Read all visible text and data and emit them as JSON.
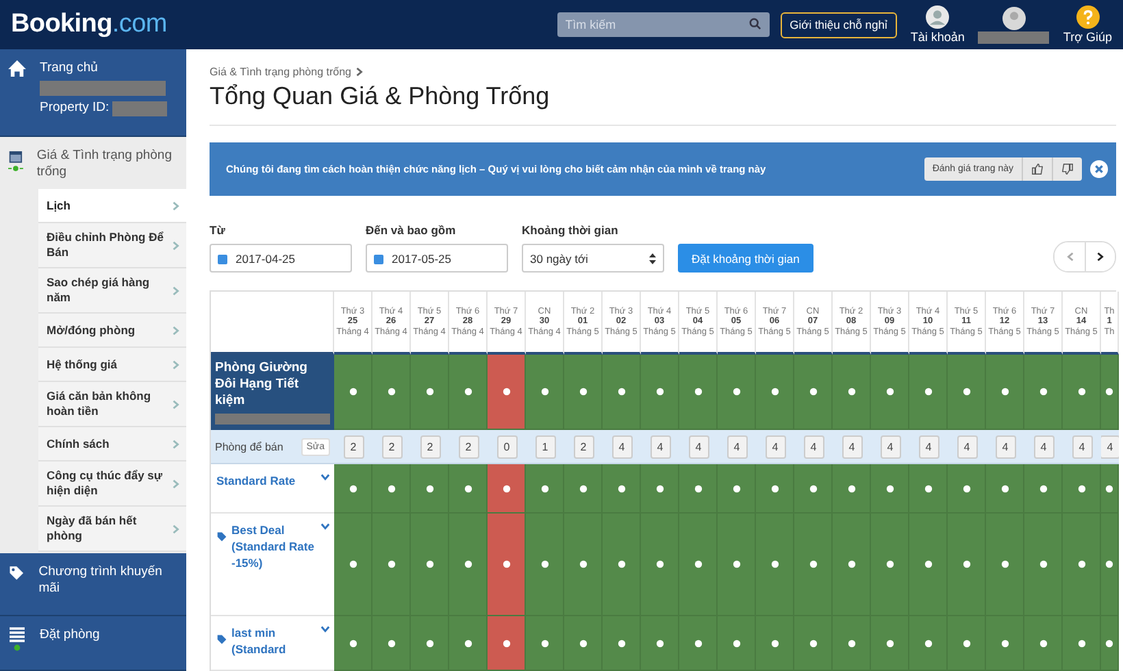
{
  "header": {
    "logo": {
      "main": "Booking",
      "suffix": ".com"
    },
    "search": {
      "placeholder": "Tìm kiếm"
    },
    "list_property": "Giới thiệu chỗ nghỉ",
    "account": "Tài khoản",
    "help": "Trợ Giúp"
  },
  "sidebar": {
    "home": {
      "label": "Trang chủ",
      "property_id": "Property ID:"
    },
    "section": {
      "label": "Giá & Tình trạng phòng trống",
      "items": [
        {
          "label": "Lịch",
          "selected": true
        },
        {
          "label": "Điều chỉnh Phòng Để Bán",
          "selected": false
        },
        {
          "label": "Sao chép giá hàng năm",
          "selected": false
        },
        {
          "label": "Mở/đóng phòng",
          "selected": false
        },
        {
          "label": "Hệ thống giá",
          "selected": false
        },
        {
          "label": "Giá căn bản không hoàn tiền",
          "selected": false
        },
        {
          "label": "Chính sách",
          "selected": false
        },
        {
          "label": "Công cụ thúc đẩy sự hiện diện",
          "selected": false
        },
        {
          "label": "Ngày đã bán hết phòng",
          "selected": false
        }
      ]
    },
    "bottom": [
      {
        "label": "Chương trình khuyến mãi",
        "kind": "tag"
      },
      {
        "label": "Đặt phòng",
        "kind": "list"
      }
    ]
  },
  "breadcrumb": "Giá & Tình trạng phòng trống",
  "title": "Tổng Quan Giá & Phòng Trống",
  "banner": {
    "text": "Chúng tôi đang tìm cách hoàn thiện chức năng lịch – Quý vị vui lòng cho biết cảm nhận của mình về trang này",
    "rate_label": "Đánh giá trang này"
  },
  "filters": {
    "from": {
      "label": "Từ",
      "value": "2017-04-25"
    },
    "to": {
      "label": "Đến và bao gồm",
      "value": "2017-05-25"
    },
    "range": {
      "label": "Khoảng thời gian",
      "value": "30 ngày tới"
    },
    "apply": "Đặt khoảng thời gian"
  },
  "calendar": {
    "room": "Phòng Giường Đôi Hạng Tiết kiệm",
    "rooms_label": "Phòng để bán",
    "edit": "Sửa",
    "rates": [
      {
        "label": "Standard Rate",
        "kind": "rate"
      },
      {
        "label": "Best Deal (Standard Rate -15%)",
        "kind": "deal"
      },
      {
        "label": "last min (Standard",
        "kind": "deal"
      }
    ],
    "days": [
      {
        "dow": "Thứ 3",
        "date": "25",
        "month": "Tháng 4",
        "rooms": "2",
        "closed": false
      },
      {
        "dow": "Thứ 4",
        "date": "26",
        "month": "Tháng 4",
        "rooms": "2",
        "closed": false
      },
      {
        "dow": "Thứ 5",
        "date": "27",
        "month": "Tháng 4",
        "rooms": "2",
        "closed": false
      },
      {
        "dow": "Thứ 6",
        "date": "28",
        "month": "Tháng 4",
        "rooms": "2",
        "closed": false
      },
      {
        "dow": "Thứ 7",
        "date": "29",
        "month": "Tháng 4",
        "rooms": "0",
        "closed": true
      },
      {
        "dow": "CN",
        "date": "30",
        "month": "Tháng 4",
        "rooms": "1",
        "closed": false
      },
      {
        "dow": "Thứ 2",
        "date": "01",
        "month": "Tháng 5",
        "rooms": "2",
        "closed": false
      },
      {
        "dow": "Thứ 3",
        "date": "02",
        "month": "Tháng 5",
        "rooms": "4",
        "closed": false
      },
      {
        "dow": "Thứ 4",
        "date": "03",
        "month": "Tháng 5",
        "rooms": "4",
        "closed": false
      },
      {
        "dow": "Thứ 5",
        "date": "04",
        "month": "Tháng 5",
        "rooms": "4",
        "closed": false
      },
      {
        "dow": "Thứ 6",
        "date": "05",
        "month": "Tháng 5",
        "rooms": "4",
        "closed": false
      },
      {
        "dow": "Thứ 7",
        "date": "06",
        "month": "Tháng 5",
        "rooms": "4",
        "closed": false
      },
      {
        "dow": "CN",
        "date": "07",
        "month": "Tháng 5",
        "rooms": "4",
        "closed": false
      },
      {
        "dow": "Thứ 2",
        "date": "08",
        "month": "Tháng 5",
        "rooms": "4",
        "closed": false
      },
      {
        "dow": "Thứ 3",
        "date": "09",
        "month": "Tháng 5",
        "rooms": "4",
        "closed": false
      },
      {
        "dow": "Thứ 4",
        "date": "10",
        "month": "Tháng 5",
        "rooms": "4",
        "closed": false
      },
      {
        "dow": "Thứ 5",
        "date": "11",
        "month": "Tháng 5",
        "rooms": "4",
        "closed": false
      },
      {
        "dow": "Thứ 6",
        "date": "12",
        "month": "Tháng 5",
        "rooms": "4",
        "closed": false
      },
      {
        "dow": "Thứ 7",
        "date": "13",
        "month": "Tháng 5",
        "rooms": "4",
        "closed": false
      },
      {
        "dow": "CN",
        "date": "14",
        "month": "Tháng 5",
        "rooms": "4",
        "closed": false
      },
      {
        "dow": "Th",
        "date": "1",
        "month": "Th",
        "rooms": "4",
        "closed": false
      }
    ]
  }
}
